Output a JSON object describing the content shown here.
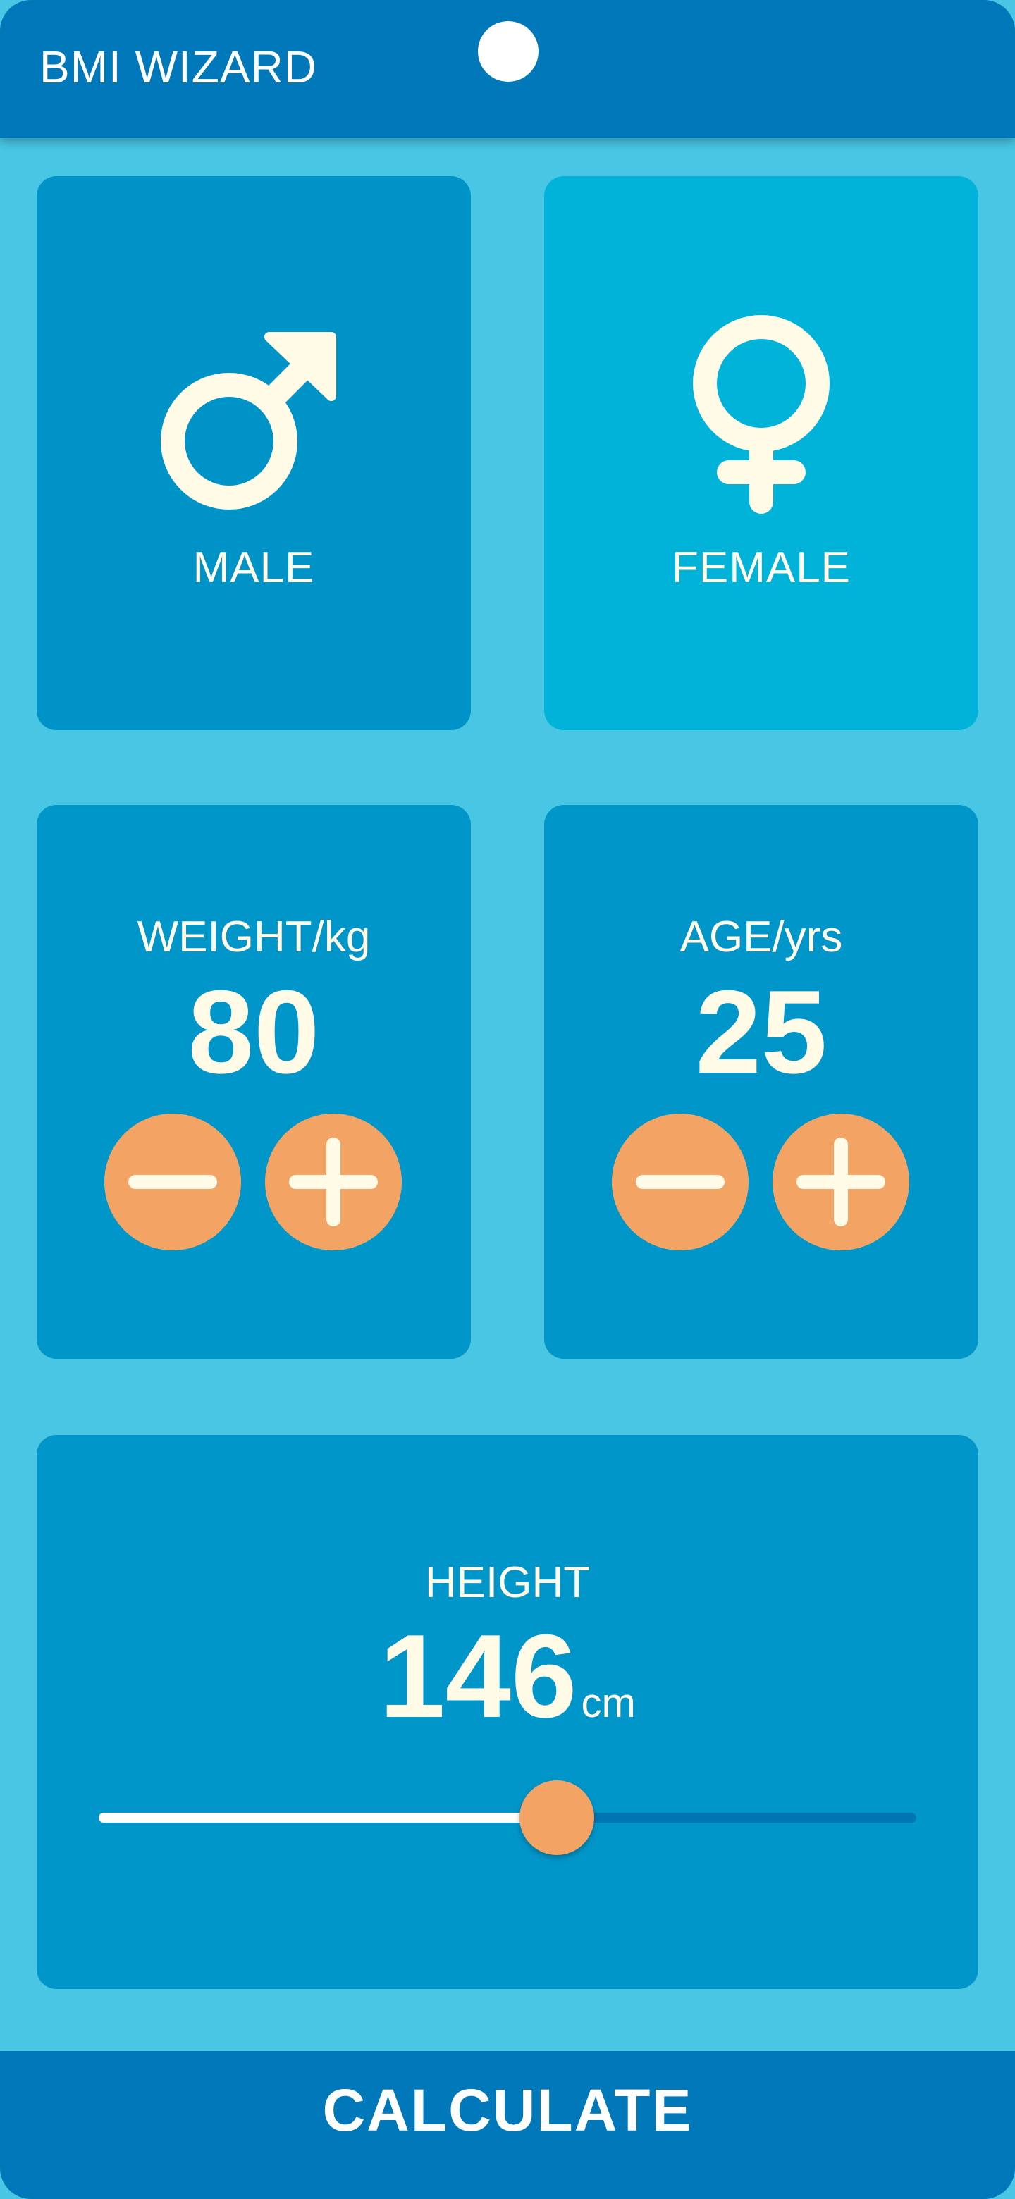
{
  "appbar": {
    "title": "BMI WIZARD"
  },
  "gender": {
    "male_label": "MALE",
    "female_label": "FEMALE",
    "male_icon": "male-symbol-icon",
    "female_icon": "female-symbol-icon"
  },
  "weight": {
    "label": "WEIGHT/kg",
    "value": "80"
  },
  "age": {
    "label": "AGE/yrs",
    "value": "25"
  },
  "height": {
    "label": "HEIGHT",
    "value": "146",
    "unit": "cm",
    "slider_fraction": 0.56
  },
  "action": {
    "calculate_label": "CALCULATE"
  },
  "colors": {
    "background": "#48C6E4",
    "appbar": "#0078B9",
    "card_inactive": "#0093C7",
    "card_active": "#01B3D8",
    "accent": "#F3A465",
    "text": "#FFFBE6"
  }
}
